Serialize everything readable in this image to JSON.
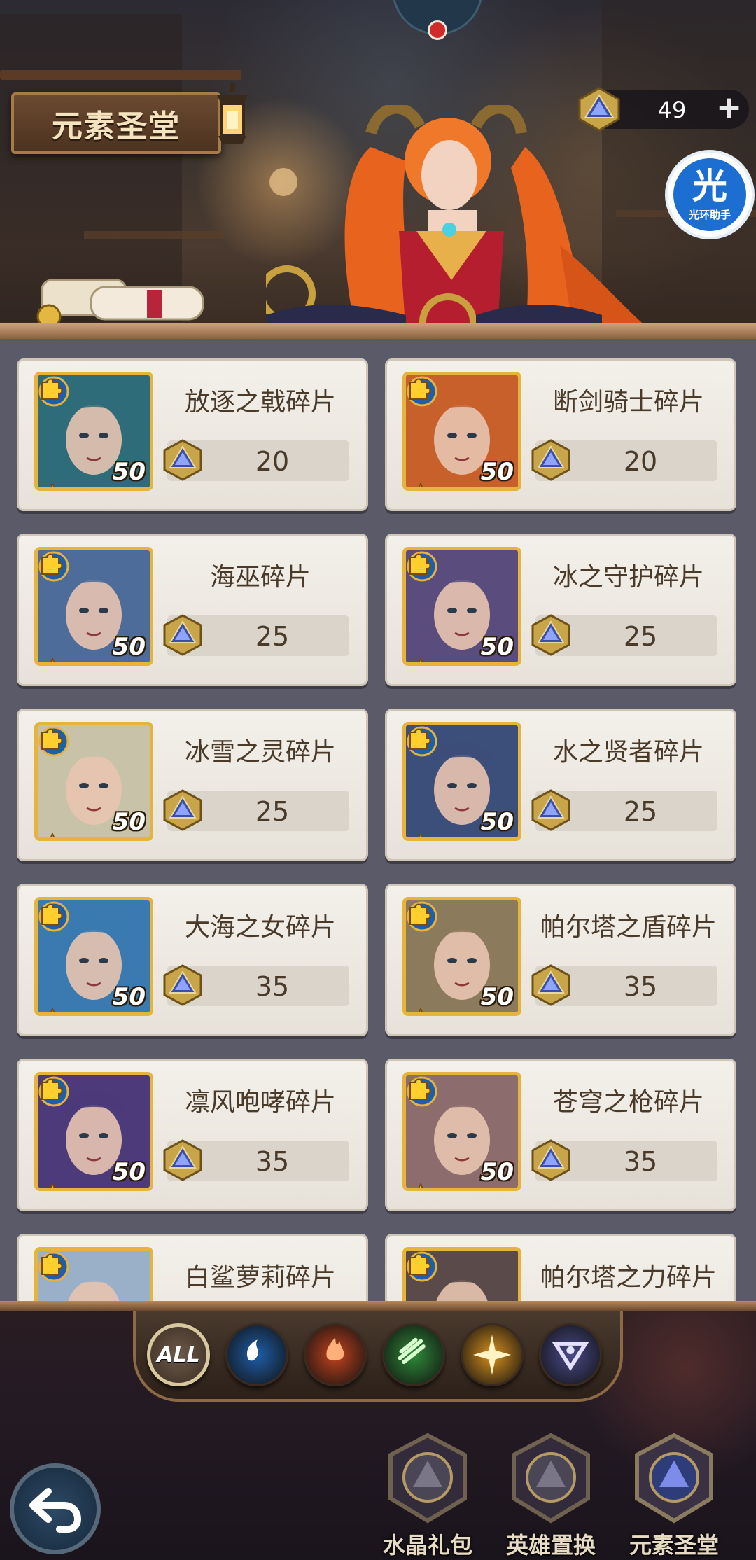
{
  "header": {
    "title": "元素圣堂",
    "currency_count": "49",
    "currency_add": "+",
    "helper_glyph": "光",
    "helper_label": "光环助手"
  },
  "items": [
    {
      "name": "放逐之戟碎片",
      "price": "20",
      "level": "50",
      "stars": 4,
      "portrait": "#2f6c7a"
    },
    {
      "name": "断剑骑士碎片",
      "price": "20",
      "level": "50",
      "stars": 4,
      "portrait": "#c8602c"
    },
    {
      "name": "海巫碎片",
      "price": "25",
      "level": "50",
      "stars": 4,
      "portrait": "#4d6c9a"
    },
    {
      "name": "冰之守护碎片",
      "price": "25",
      "level": "50",
      "stars": 4,
      "portrait": "#5a4c7c"
    },
    {
      "name": "冰雪之灵碎片",
      "price": "25",
      "level": "50",
      "stars": 4,
      "portrait": "#c8c2a8"
    },
    {
      "name": "水之贤者碎片",
      "price": "25",
      "level": "50",
      "stars": 4,
      "portrait": "#3c4e7a"
    },
    {
      "name": "大海之女碎片",
      "price": "35",
      "level": "50",
      "stars": 4,
      "portrait": "#3a7ab0"
    },
    {
      "name": "帕尔塔之盾碎片",
      "price": "35",
      "level": "50",
      "stars": 4,
      "portrait": "#8c7a5c"
    },
    {
      "name": "凛风咆哮碎片",
      "price": "35",
      "level": "50",
      "stars": 4,
      "portrait": "#4c3a7a"
    },
    {
      "name": "苍穹之枪碎片",
      "price": "35",
      "level": "50",
      "stars": 4,
      "portrait": "#8c6c6c"
    },
    {
      "name": "白鲨萝莉碎片",
      "price": "",
      "level": "",
      "stars": 0,
      "portrait": "#9ab0c8"
    },
    {
      "name": "帕尔塔之力碎片",
      "price": "",
      "level": "",
      "stars": 0,
      "portrait": "#5a4a4a"
    }
  ],
  "filters": {
    "all_label": "ALL",
    "elements": [
      {
        "icon": "water-element-icon",
        "color": "#1f5ea8"
      },
      {
        "icon": "fire-element-icon",
        "color": "#c2431e"
      },
      {
        "icon": "wind-element-icon",
        "color": "#2f8a3a"
      },
      {
        "icon": "light-element-icon",
        "color": "#d8901e"
      },
      {
        "icon": "dark-element-icon",
        "color": "#4a4a8a"
      }
    ]
  },
  "bottom_nav": [
    {
      "label": "水晶礼包",
      "icon": "crystal-pack-icon"
    },
    {
      "label": "英雄置换",
      "icon": "hero-swap-icon"
    },
    {
      "label": "元素圣堂",
      "icon": "element-sanctum-icon"
    }
  ],
  "colors": {
    "card_bg": "#f0ece5",
    "panel_bg": "#5a5a68",
    "frame_gold": "#e6b43c",
    "water_badge": "#1f5ea8"
  }
}
